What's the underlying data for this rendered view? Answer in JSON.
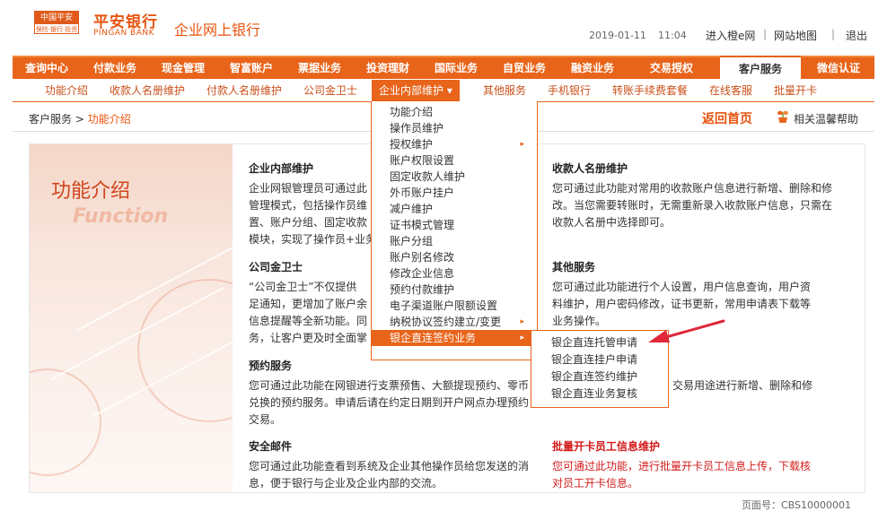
{
  "header": {
    "logo_badge_top": "中国平安",
    "logo_badge_bottom": "保险·银行·投资",
    "logo_cn": "平安银行",
    "logo_en": "PINGAN BANK",
    "portal_title": "企业网上银行",
    "date": "2019-01-11",
    "time": "11:04",
    "links": [
      "进入橙e网",
      "网站地图",
      "退出"
    ]
  },
  "main_nav": {
    "items": [
      "查询中心",
      "付款业务",
      "现金管理",
      "智富账户",
      "票据业务",
      "投资理财",
      "国际业务",
      "自贸业务",
      "融资业务",
      "交易授权",
      "客户服务",
      "微信认证"
    ],
    "active": "客户服务"
  },
  "sub_nav": {
    "items": [
      "功能介绍",
      "收款人名册维护",
      "付款人名册维护",
      "公司金卫士",
      "企业内部维护 ▾",
      "其他服务",
      "手机银行",
      "转账手续费套餐",
      "在线客服",
      "批量开卡"
    ],
    "active": "企业内部维护 ▾"
  },
  "breadcrumb": {
    "root": "客户服务",
    "sep": ">",
    "current": "功能介绍"
  },
  "actions": {
    "back_home": "返回首页",
    "help": "相关温馨帮助"
  },
  "banner": {
    "title_cn": "功能介绍",
    "title_en": "Function"
  },
  "sections_left": [
    {
      "title": "企业内部维护",
      "body": [
        "企业网银管理员可通过此",
        "管理模式，包括操作员维",
        "置、账户分组、固定收款",
        "模块，实现了操作员+业务"
      ]
    },
    {
      "title": "公司金卫士",
      "body": [
        "“公司金卫士”不仅提供",
        "足通知，更增加了账户余",
        "信息提醒等全新功能。同",
        "务，让客户更及时全面掌"
      ]
    },
    {
      "title": "预约服务",
      "body": [
        "您可通过此功能在网银进行支票预售、大额提现预约、零币",
        "兑换的预约服务。申请后请在约定日期到开户网点办理预约",
        "交易。"
      ]
    },
    {
      "title": "安全邮件",
      "body": [
        "您可通过此功能查看到系统及企业其他操作员给您发送的消",
        "息，便于银行与企业及企业内部的交流。"
      ]
    }
  ],
  "sections_right": [
    {
      "title": "收款人名册维护",
      "body": [
        "您可通过此功能对常用的收款账户信息进行新增、删除和修",
        "改。当您需要转账时，无需重新录入收款账户信息，只需在",
        "收款人名册中选择即可。"
      ]
    },
    {
      "title": "其他服务",
      "body": [
        "您可通过此功能进行个人设置，用户信息查询，用户资",
        "料维护，用户密码修改，证书更新，常用申请表下载等",
        "业务操作。"
      ]
    },
    {
      "title": "",
      "body": [
        "交易用途进行新增、删除和修"
      ]
    },
    {
      "title": "批量开卡员工信息维护",
      "body": [
        "您可通过此功能，进行批量开卡员工信息上传，下载核",
        "对员工开卡信息。"
      ]
    }
  ],
  "dropdown": {
    "items": [
      "功能介绍",
      "操作员维护",
      "授权维护",
      "账户权限设置",
      "固定收款人维护",
      "外币账户挂户",
      "减户维护",
      "证书模式管理",
      "账户分组",
      "账户别名修改",
      "修改企业信息",
      "预约付款维护",
      "电子渠道账户限额设置",
      "纳税协议签约建立/变更",
      "银企直连签约业务"
    ],
    "has_submenu": [
      "授权维护",
      "纳税协议签约建立/变更",
      "银企直连签约业务"
    ],
    "active": "银企直连签约业务",
    "arrow_glyph": "▸"
  },
  "submenu": {
    "items": [
      "银企直连托管申请",
      "银企直连挂户申请",
      "银企直连签约维护",
      "银企直连业务复核"
    ]
  },
  "colors": {
    "brand": "#e8641a",
    "brand_text": "#e8540f",
    "alert_red": "#d21b1b",
    "pointer_arrow": "#e0283a"
  },
  "footer": {
    "page_no": "页面号：CBS10000001"
  }
}
